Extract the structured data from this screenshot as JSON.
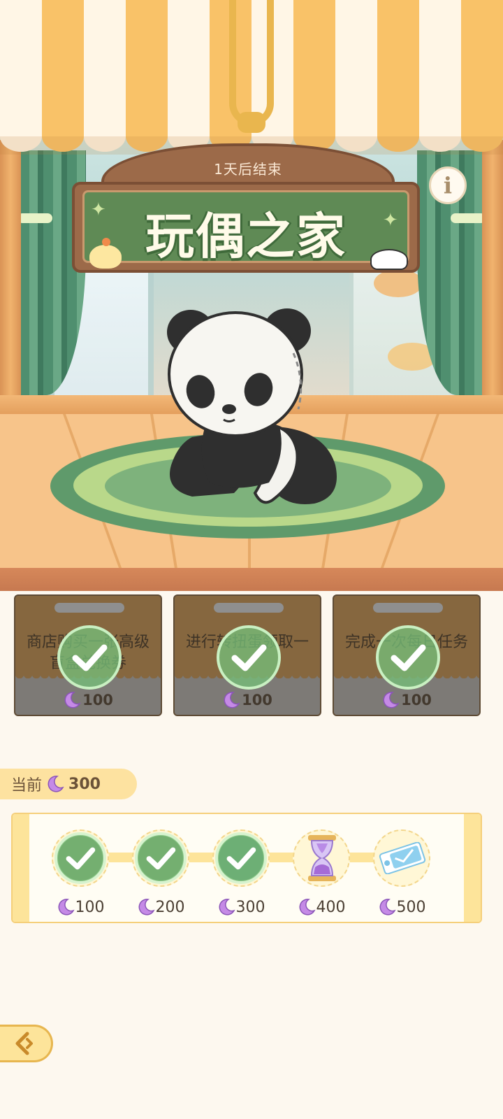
{
  "event": {
    "timer_text": "1天后结束",
    "title": "玩偶之家"
  },
  "tasks": [
    {
      "description": "商店购买一张高级盲盒兑换券",
      "reward": "100",
      "completed": true
    },
    {
      "description": "进行转扭蛋领取一",
      "reward": "100",
      "completed": true
    },
    {
      "description": "完成一次每日任务",
      "reward": "100",
      "completed": true
    }
  ],
  "current": {
    "label": "当前",
    "value": "300"
  },
  "milestones": [
    {
      "value": "100",
      "completed": true,
      "reward_icon": "gift-box-icon"
    },
    {
      "value": "200",
      "completed": true,
      "reward_icon": "gift-box-icon"
    },
    {
      "value": "300",
      "completed": true,
      "reward_icon": "gift-box-icon"
    },
    {
      "value": "400",
      "completed": false,
      "reward_icon": "hourglass-icon"
    },
    {
      "value": "500",
      "completed": false,
      "reward_icon": "ticket-icon"
    }
  ],
  "icons": {
    "info": "info-icon",
    "currency": "moon-icon",
    "back": "back-arrow-icon"
  },
  "colors": {
    "accent": "#fde49a",
    "sign_green": "#5f8a55",
    "check_green": "#76be78",
    "moon_purple": "#a56bd6"
  }
}
